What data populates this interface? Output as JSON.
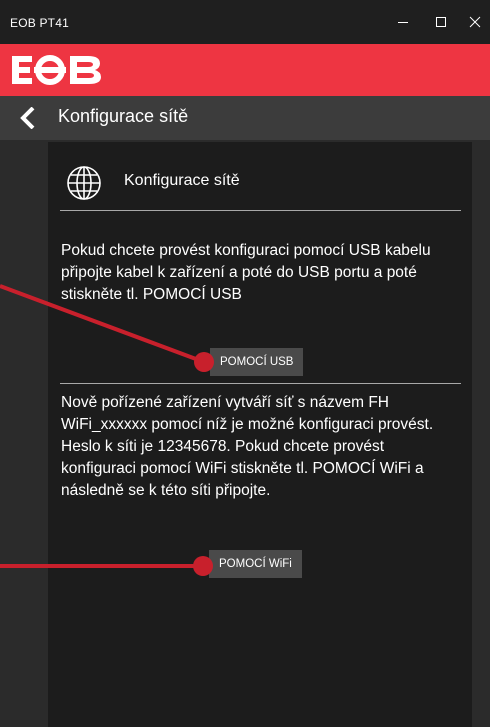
{
  "window": {
    "title": "EOB PT41",
    "controls": {
      "minimize_icon": "minimize-icon",
      "maximize_icon": "maximize-icon",
      "close_icon": "close-icon"
    }
  },
  "brand": {
    "logo_text": "EOB",
    "color": "#ee3542"
  },
  "nav": {
    "back_icon": "chevron-left-icon",
    "title": "Konfigurace sítě"
  },
  "panel": {
    "icon": "globe-icon",
    "title": "Konfigurace sítě",
    "usb": {
      "text": "Pokud chcete provést konfiguraci pomocí USB kabelu připojte kabel k zařízení a poté do USB portu a poté stiskněte tl. POMOCÍ USB",
      "button": "POMOCÍ USB"
    },
    "wifi": {
      "text": "Nově pořízené zařízení vytváří síť s názvem FH WiFi_xxxxxx pomocí níž je možné konfiguraci provést. Heslo k síti je 12345678. Pokud chcete provést konfiguraci pomocí  WiFi stiskněte tl. POMOCÍ WiFi a následně se k této síti připojte.",
      "button": "POMOCÍ WiFi"
    }
  },
  "colors": {
    "annotation": "#c8202c",
    "background": "#2b2b2b",
    "panel": "#1c1c1c",
    "titlebar": "#1f1f1f"
  }
}
